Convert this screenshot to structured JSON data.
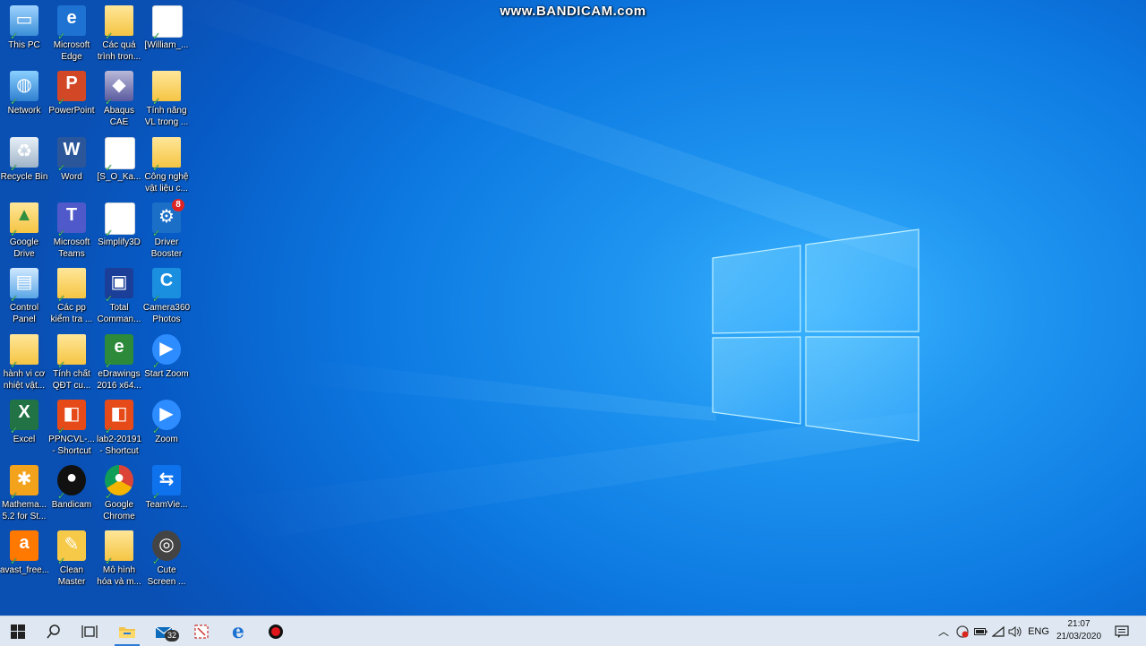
{
  "watermark": "www.BANDICAM.com",
  "desktop_icons": [
    {
      "label": "This PC",
      "icon": "this-pc-icon"
    },
    {
      "label": "Microsoft Edge",
      "icon": "edge-icon"
    },
    {
      "label": "Các quá trình tron...",
      "icon": "folder-icon"
    },
    {
      "label": "[William_...",
      "icon": "pdf-icon"
    },
    {
      "label": "Network",
      "icon": "network-icon"
    },
    {
      "label": "PowerPoint",
      "icon": "powerpoint-icon"
    },
    {
      "label": "Abaqus CAE",
      "icon": "abaqus-icon"
    },
    {
      "label": "Tính năng VL trong ...",
      "icon": "folder-icon"
    },
    {
      "label": "Recycle Bin",
      "icon": "recycle-bin-icon"
    },
    {
      "label": "Word",
      "icon": "word-icon"
    },
    {
      "label": "[S_O_Ka...",
      "icon": "pdf-icon"
    },
    {
      "label": "Công nghệ vật liệu c...",
      "icon": "folder-icon"
    },
    {
      "label": "Google Drive",
      "icon": "google-drive-icon"
    },
    {
      "label": "Microsoft Teams",
      "icon": "teams-icon"
    },
    {
      "label": "Simplify3D",
      "icon": "file-icon"
    },
    {
      "label": "Driver Booster",
      "icon": "driver-booster-icon",
      "badge": "8"
    },
    {
      "label": "Control Panel",
      "icon": "control-panel-icon"
    },
    {
      "label": "Các pp kiểm tra ...",
      "icon": "folder-icon"
    },
    {
      "label": "Total Comman...",
      "icon": "total-commander-icon"
    },
    {
      "label": "Camera360 Photos",
      "icon": "camera360-icon"
    },
    {
      "label": "hành vi cơ nhiệt vật...",
      "icon": "folder-icon"
    },
    {
      "label": "Tính chất QĐT cu...",
      "icon": "folder-icon"
    },
    {
      "label": "eDrawings 2016 x64...",
      "icon": "edrawings-icon"
    },
    {
      "label": "Start Zoom",
      "icon": "zoom-icon"
    },
    {
      "label": "Excel",
      "icon": "excel-icon"
    },
    {
      "label": "PPNCVL-... - Shortcut",
      "icon": "office-icon"
    },
    {
      "label": "lab2-20191 - Shortcut",
      "icon": "office-icon"
    },
    {
      "label": "Zoom",
      "icon": "zoom-icon"
    },
    {
      "label": "Mathema... 5.2 for St...",
      "icon": "mathematica-icon"
    },
    {
      "label": "Bandicam",
      "icon": "bandicam-icon"
    },
    {
      "label": "Google Chrome",
      "icon": "chrome-icon"
    },
    {
      "label": "TeamVie...",
      "icon": "teamviewer-icon"
    },
    {
      "label": "avast_free...",
      "icon": "avast-icon"
    },
    {
      "label": "Clean Master",
      "icon": "clean-master-icon"
    },
    {
      "label": "Mô hình hóa và m...",
      "icon": "folder-icon"
    },
    {
      "label": "Cute Screen ...",
      "icon": "cute-screen-icon"
    }
  ],
  "taskbar": {
    "mail_badge": "32",
    "language": "ENG",
    "time": "21:07",
    "date": "21/03/2020"
  },
  "colors": {
    "desktop_blue": "#1f95f0",
    "taskbar": "#dfe8f2",
    "accent": "#2c7ad6"
  }
}
